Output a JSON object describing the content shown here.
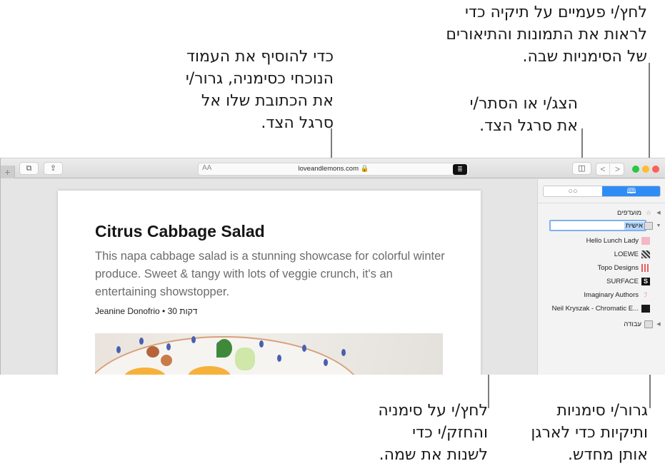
{
  "callouts": {
    "double_click_folder": [
      "לחץ/י פעמיים על תיקיה כדי",
      "לראות את התמונות והתיאורים",
      "של הסימניות שבה."
    ],
    "toggle_sidebar": [
      "הצג/י או הסתר/י",
      "את סרגל הצד."
    ],
    "add_bookmark": [
      "כדי להוסיף את העמוד",
      "הנוכחי כסימניה, גרור/י",
      "את הכתובת שלו אל",
      "סרגל הצד."
    ],
    "rename_bookmark": [
      "לחץ/י על סימניה",
      "והחזק/י כדי",
      "לשנות את שמה."
    ],
    "reorganize": [
      "גרור/י סימניות",
      "ותיקיות כדי לארגן",
      "אותן מחדש."
    ]
  },
  "toolbar": {
    "new_tab_label": "+",
    "tabs_icon": "⧉",
    "share_icon": "⇪",
    "text_size_label": "AA",
    "url": "loveandlemons.com 🔒",
    "reader_icon": "≣",
    "sidebar_icon": "◫",
    "back_label": "<",
    "forward_label": ">"
  },
  "traffic_lights": {
    "close": "#fe5f57",
    "minimize": "#febc2e",
    "zoom": "#28c840"
  },
  "article": {
    "title": "Citrus Cabbage Salad",
    "description": "This napa cabbage salad is a stunning showcase for colorful winter produce. Sweet & tangy with lots of veggie crunch, it's an entertaining showstopper.",
    "meta": "Jeanine Donofrio • 30 דקות"
  },
  "sidebar": {
    "reading_list_icon": "○○",
    "bookmarks_icon": "📖",
    "accent": "#2f8cf5",
    "favorites_label": "מועדפים",
    "editing_folder_value": "אישית",
    "bookmarks": [
      {
        "label": "Hello Lunch Lady",
        "icon_color": "#f4b8c4"
      },
      {
        "label": "LOEWE",
        "icon_color": "#888888"
      },
      {
        "label": "Topo Designs",
        "icon_color": "#e55a5a"
      },
      {
        "label": "SURFACE",
        "icon_color": "#111111"
      },
      {
        "label": "Imaginary Authors",
        "icon_color": "#e27f7f"
      },
      {
        "label": "Neil Kryszak - Chromatic E...",
        "icon_color": "#1a1a1a"
      }
    ],
    "work_folder_label": "עבודה"
  }
}
